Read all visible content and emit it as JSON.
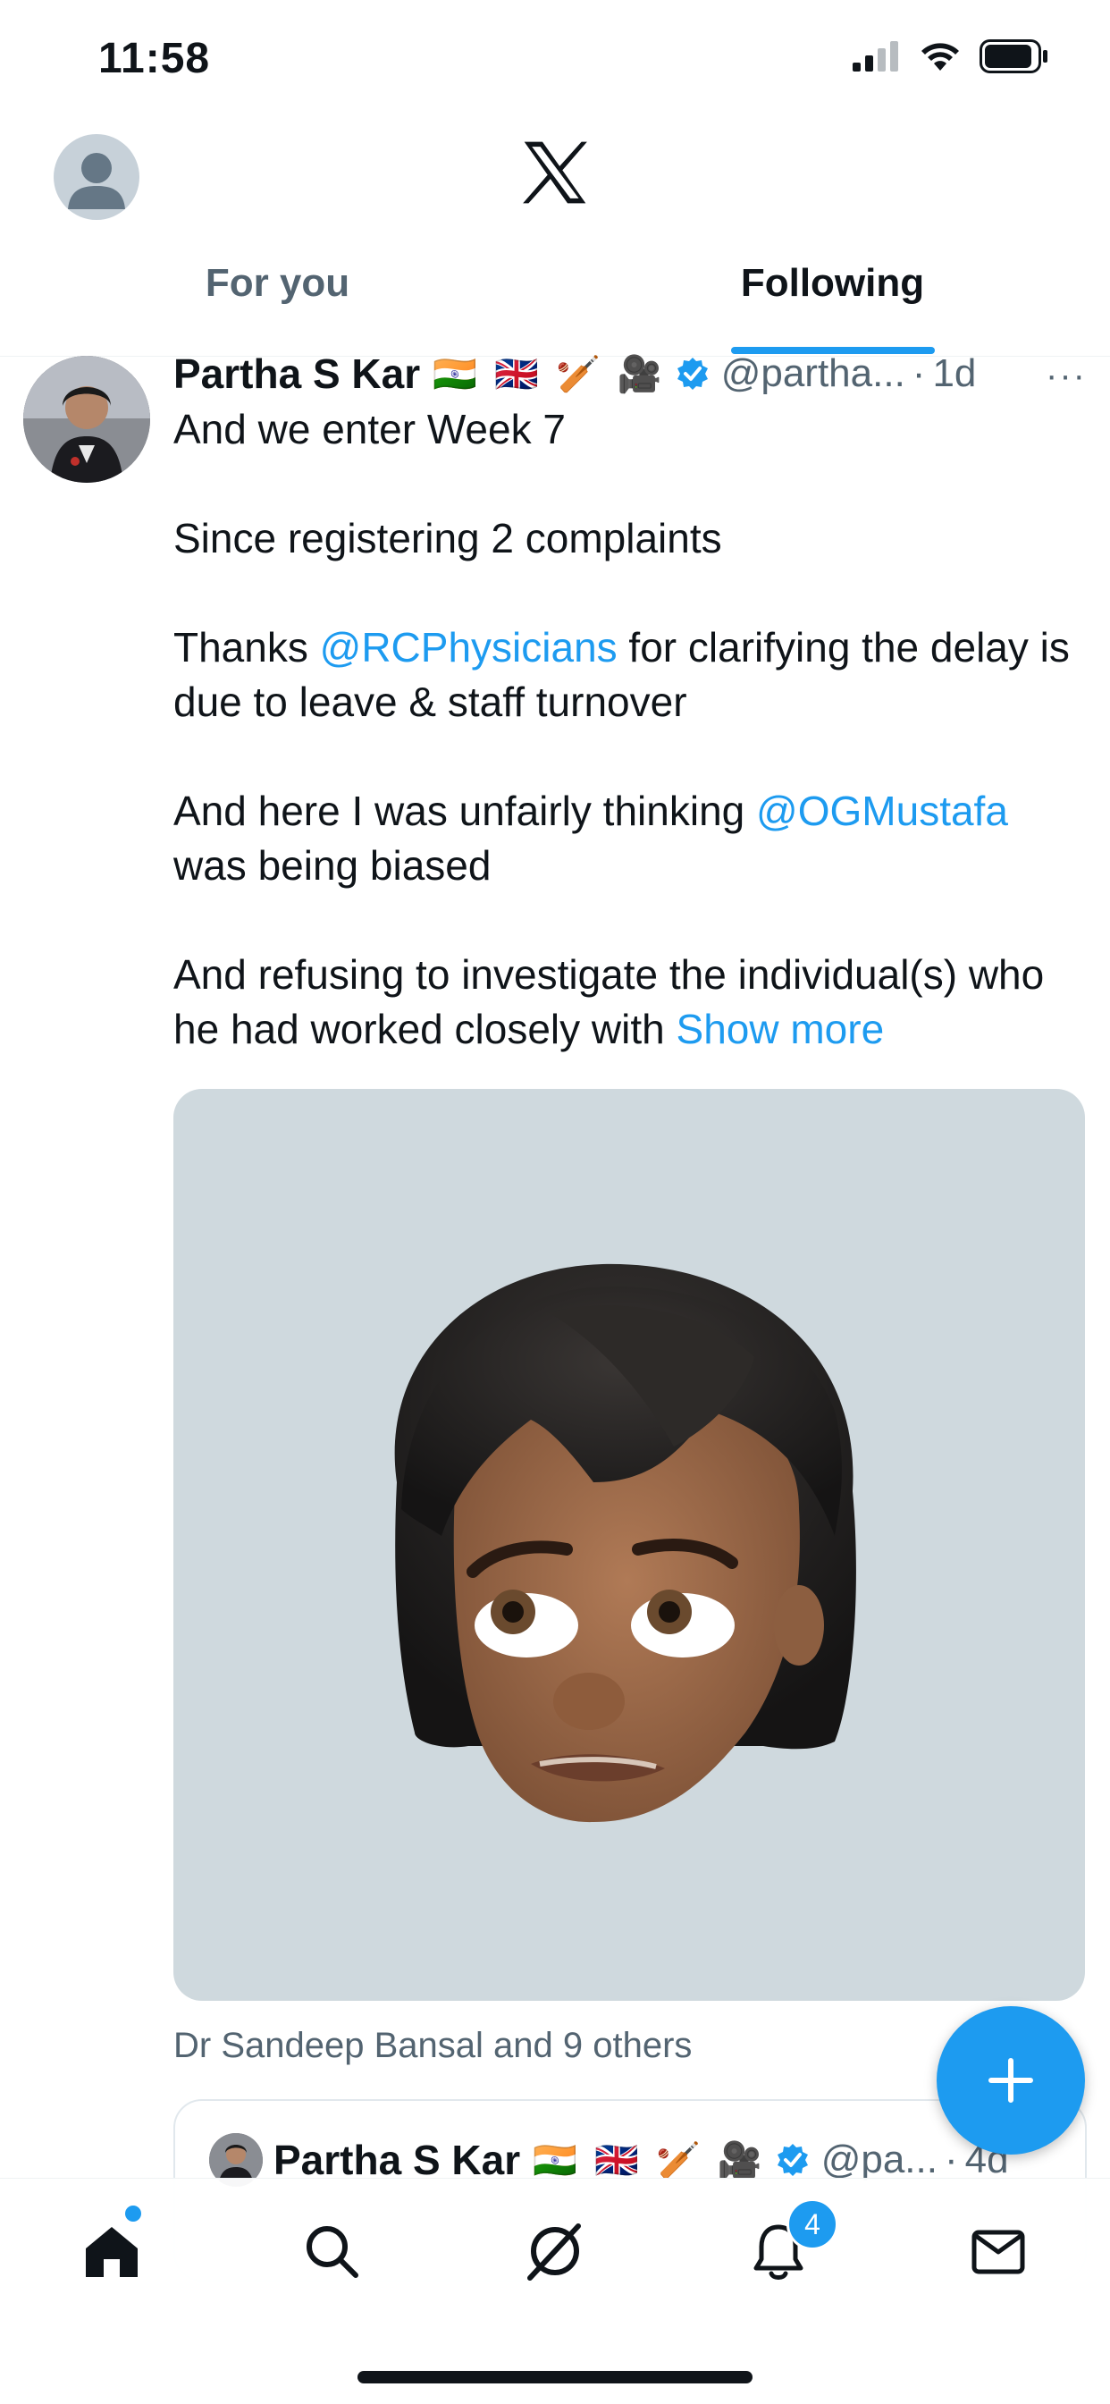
{
  "status_bar": {
    "time": "11:58"
  },
  "header": {
    "logo": "x-logo-icon",
    "tabs": [
      {
        "label": "For you",
        "active": false
      },
      {
        "label": "Following",
        "active": true
      }
    ]
  },
  "tweet": {
    "name": "Partha S Kar",
    "emojis": "🇮🇳 🇬🇧 🏏 🎥",
    "handle": "@partha...",
    "separator": "·",
    "time": "1d",
    "more": "···",
    "body": {
      "line1": "And we enter Week 7",
      "line2": "Since registering 2 complaints",
      "line3_pre": "Thanks ",
      "line3_link": "@RCPhysicians",
      "line3_post": " for clarifying the delay is due to leave & staff turnover",
      "line4_pre": "And here I was unfairly thinking ",
      "line4_link": "@OGMustafa",
      "line4_post": " was being biased",
      "line5": "And refusing to investigate the individual(s) who he had worked closely with ",
      "show_more": "Show more"
    },
    "social_context": "Dr Sandeep Bansal and 9 others"
  },
  "quoted_tweet": {
    "name": "Partha S Kar",
    "emojis": "🇮🇳 🇬🇧 🏏 🎥",
    "handle": "@pa...",
    "separator": "·",
    "time": "4d"
  },
  "bottom_nav": {
    "items": [
      "home-icon",
      "search-icon",
      "grok-icon",
      "notifications-icon",
      "messages-icon"
    ],
    "notification_count": "4"
  },
  "colors": {
    "accent": "#1d9bf0",
    "text": "#0f1419",
    "secondary": "#536471",
    "media_bg": "#cfd9de"
  }
}
